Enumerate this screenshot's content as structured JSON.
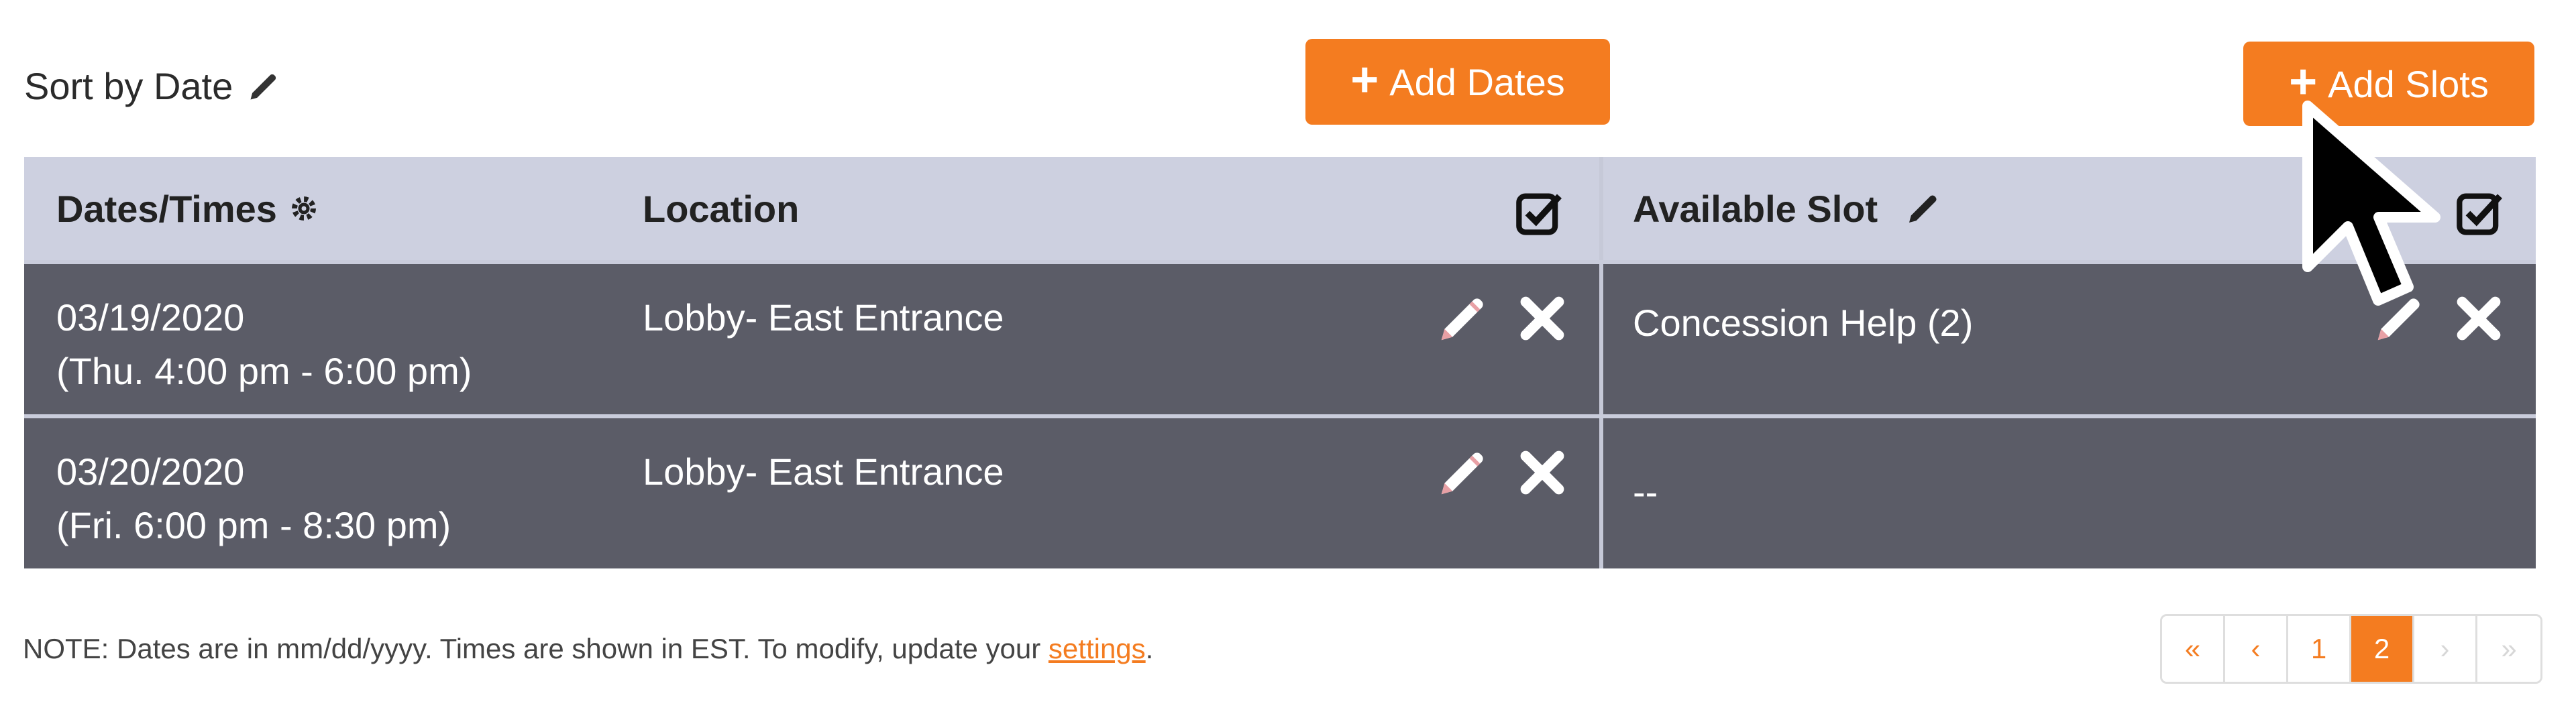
{
  "toolbar": {
    "sort_label": "Sort by Date",
    "add_dates_label": "Add Dates",
    "add_slots_label": "Add Slots"
  },
  "table": {
    "headers": {
      "dates": "Dates/Times",
      "location": "Location",
      "slot": "Available Slot"
    },
    "rows": [
      {
        "date": "03/19/2020",
        "time": "(Thu. 4:00 pm - 6:00 pm)",
        "location": "Lobby- East Entrance",
        "slot": "Concession Help (2)"
      },
      {
        "date": "03/20/2020",
        "time": "(Fri. 6:00 pm - 8:30 pm)",
        "location": "Lobby- East Entrance",
        "slot": "--"
      }
    ]
  },
  "note": {
    "text": "NOTE: Dates are in mm/dd/yyyy. Times are shown in EST. To modify, update your ",
    "link": "settings",
    "suffix": "."
  },
  "pagination": {
    "first": "«",
    "prev": "‹",
    "pages": [
      "1",
      "2"
    ],
    "current": "2",
    "next": "›",
    "last": "»"
  },
  "colors": {
    "accent": "#f47c20",
    "header_bg": "#cdd0e0",
    "row_bg": "#5b5c67"
  },
  "icons": [
    "pencil-icon",
    "gear-icon",
    "checkbox-icon",
    "close-icon",
    "plus-icon",
    "cursor-icon"
  ]
}
